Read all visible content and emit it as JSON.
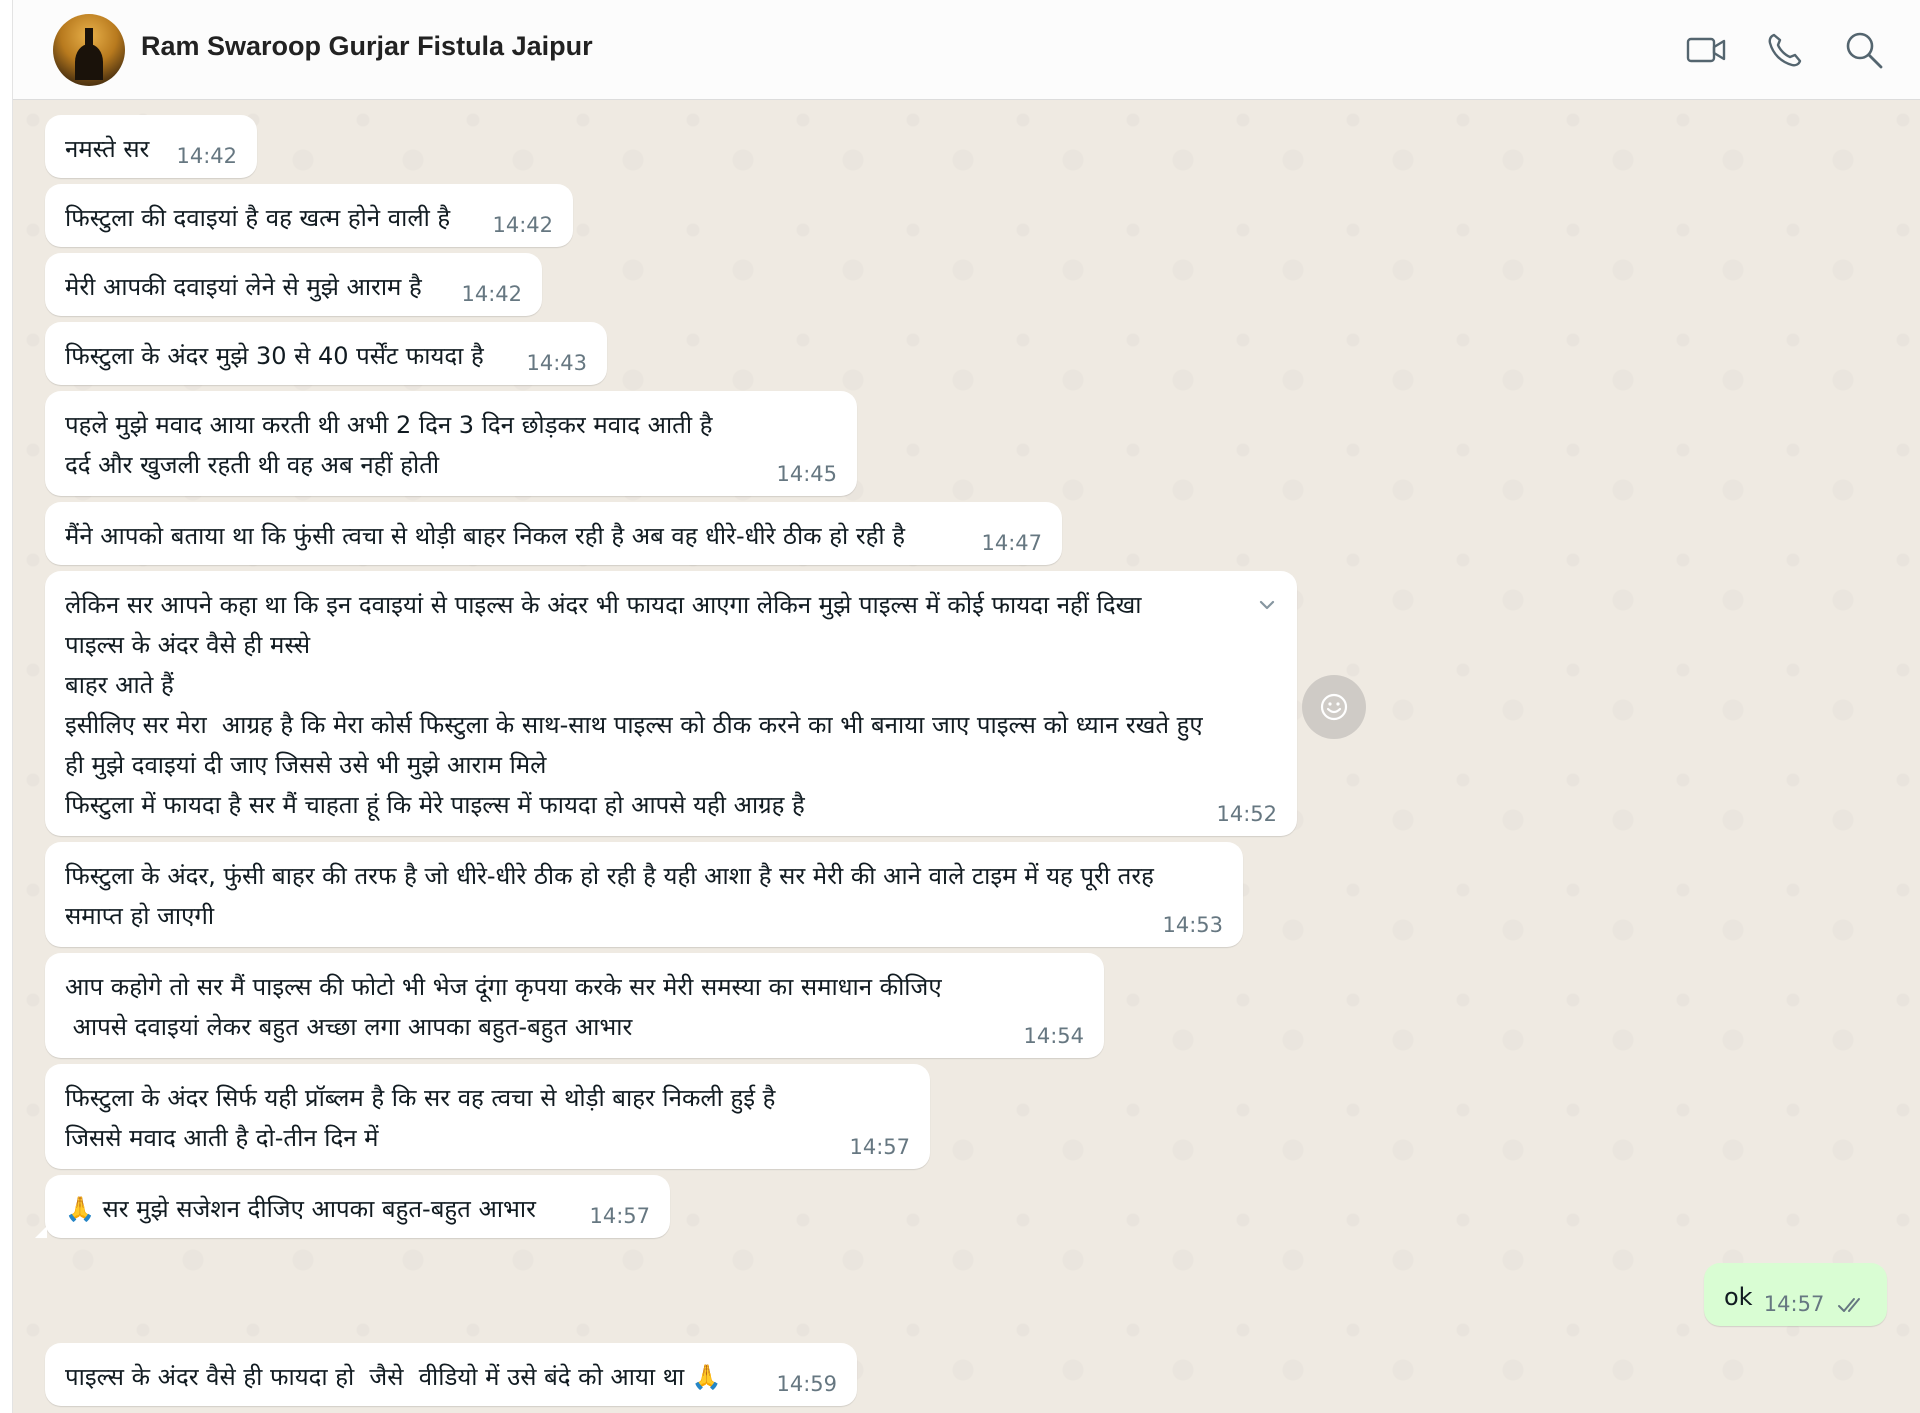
{
  "header": {
    "contact_name": "Ram Swaroop Gurjar Fistula Jaipur",
    "avatar_icon": "temple-avatar",
    "icons": [
      "video-call-icon",
      "voice-call-icon",
      "search-icon"
    ]
  },
  "messages": [
    {
      "dir": "in",
      "text": "नमस्ते सर",
      "time": "14:42"
    },
    {
      "dir": "in",
      "text": "फिस्टुला की दवाइयां है वह खत्म होने वाली है",
      "time": "14:42"
    },
    {
      "dir": "in",
      "text": "मेरी आपकी दवाइयां लेने से मुझे आराम है",
      "time": "14:42"
    },
    {
      "dir": "in",
      "text": "फिस्टुला के अंदर मुझे 30 से 40 पर्सेंट फायदा है",
      "time": "14:43"
    },
    {
      "dir": "in",
      "text": "पहले मुझे मवाद आया करती थी अभी 2 दिन 3 दिन छोड़कर मवाद आती है\nदर्द और खुजली रहती थी वह अब नहीं होती",
      "time": "14:45"
    },
    {
      "dir": "in",
      "text": "मैंने आपको बताया था कि फुंसी त्वचा से थोड़ी बाहर निकल रही है अब वह धीरे-धीरे ठीक हो रही है",
      "time": "14:47"
    },
    {
      "dir": "in",
      "text": "लेकिन सर आपने कहा था कि इन दवाइयां से पाइल्स के अंदर भी फायदा आएगा लेकिन मुझे पाइल्स में कोई फायदा नहीं दिखा\nपाइल्स के अंदर वैसे ही मस्से\nबाहर आते हैं\nइसीलिए सर मेरा  आग्रह है कि मेरा कोर्स फिस्टुला के साथ-साथ पाइल्स को ठीक करने का भी बनाया जाए पाइल्स को ध्यान रखते हुए\nही मुझे दवाइयां दी जाए जिससे उसे भी मुझे आराम मिले\nफिस्टुला में फायदा है सर मैं चाहता हूं कि मेरे पाइल्स में फायदा हो आपसे यही आग्रह है",
      "time": "14:52"
    },
    {
      "dir": "in",
      "text": "फिस्टुला के अंदर, फुंसी बाहर की तरफ है जो धीरे-धीरे ठीक हो रही है यही आशा है सर मेरी की आने वाले टाइम में यह पूरी तरह\nसमाप्त हो जाएगी",
      "time": "14:53"
    },
    {
      "dir": "in",
      "text": "आप कहोगे तो सर मैं पाइल्स की फोटो भी भेज दूंगा कृपया करके सर मेरी समस्या का समाधान कीजिए\n आपसे दवाइयां लेकर बहुत अच्छा लगा आपका बहुत-बहुत आभार",
      "time": "14:54"
    },
    {
      "dir": "in",
      "text": "फिस्टुला के अंदर सिर्फ यही प्रॉब्लम है कि सर वह त्वचा से थोड़ी बाहर निकली हुई है\nजिससे मवाद आती है दो-तीन दिन में",
      "time": "14:57"
    },
    {
      "dir": "in",
      "text": "🙏 सर मुझे सजेशन दीजिए आपका बहुत-बहुत आभार",
      "time": "14:57"
    },
    {
      "dir": "out",
      "text": "ok",
      "time": "14:57",
      "status": "read-double-check-icon"
    },
    {
      "dir": "in",
      "text": "पाइल्स के अंदर वैसे ही फायदा हो  जैसे  वीडियो में उसे बंदे को आया था 🙏",
      "time": "14:59"
    }
  ],
  "colors": {
    "chat_background": "#efeae2",
    "incoming_bubble": "#ffffff",
    "outgoing_bubble": "#d9fdd3",
    "timestamp": "#667781"
  }
}
